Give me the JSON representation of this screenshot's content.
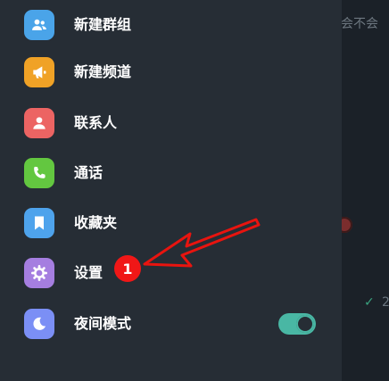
{
  "menu": {
    "items": [
      {
        "label": "新建群组",
        "icon": "group-icon",
        "color": "#4aa4e9"
      },
      {
        "label": "新建频道",
        "icon": "megaphone-icon",
        "color": "#f0a226"
      },
      {
        "label": "联系人",
        "icon": "person-icon",
        "color": "#ec6463"
      },
      {
        "label": "通话",
        "icon": "phone-icon",
        "color": "#63c740"
      },
      {
        "label": "收藏夹",
        "icon": "bookmark-icon",
        "color": "#4ea3ec"
      },
      {
        "label": "设置",
        "icon": "gear-icon",
        "color": "#a57ee0"
      },
      {
        "label": "夜间模式",
        "icon": "moon-icon",
        "color": "#7b8ff5"
      }
    ]
  },
  "night_mode": {
    "enabled": true
  },
  "annotation": {
    "badge": "1",
    "arrow_color": "#e8140f"
  },
  "chat_preview": {
    "snippet": "会不会",
    "check_text": "2"
  }
}
